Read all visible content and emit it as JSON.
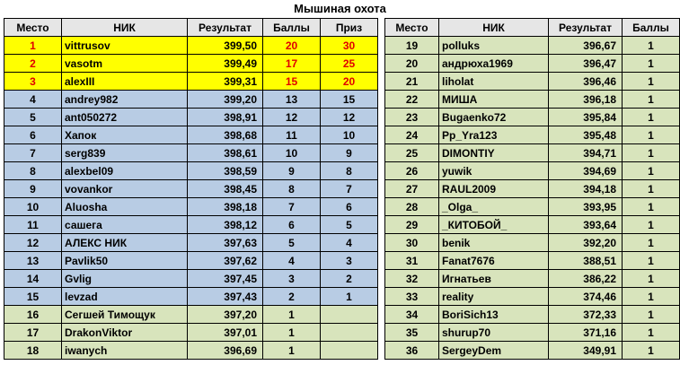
{
  "title": "Мышиная охота",
  "left": {
    "headers": [
      "Место",
      "НИК",
      "Результат",
      "Баллы",
      "Приз"
    ],
    "rows": [
      {
        "place": "1",
        "nick": "vittrusov",
        "result": "399,50",
        "points": "20",
        "prize": "30",
        "style": "gold"
      },
      {
        "place": "2",
        "nick": "vasotm",
        "result": "399,49",
        "points": "17",
        "prize": "25",
        "style": "gold"
      },
      {
        "place": "3",
        "nick": "alexIII",
        "result": "399,31",
        "points": "15",
        "prize": "20",
        "style": "gold"
      },
      {
        "place": "4",
        "nick": "andrey982",
        "result": "399,20",
        "points": "13",
        "prize": "15",
        "style": "blue"
      },
      {
        "place": "5",
        "nick": "ant050272",
        "result": "398,91",
        "points": "12",
        "prize": "12",
        "style": "blue"
      },
      {
        "place": "6",
        "nick": "Хапок",
        "result": "398,68",
        "points": "11",
        "prize": "10",
        "style": "blue"
      },
      {
        "place": "7",
        "nick": "serg839",
        "result": "398,61",
        "points": "10",
        "prize": "9",
        "style": "blue"
      },
      {
        "place": "8",
        "nick": "alexbel09",
        "result": "398,59",
        "points": "9",
        "prize": "8",
        "style": "blue"
      },
      {
        "place": "9",
        "nick": "vovankor",
        "result": "398,45",
        "points": "8",
        "prize": "7",
        "style": "blue"
      },
      {
        "place": "10",
        "nick": "Aluosha",
        "result": "398,18",
        "points": "7",
        "prize": "6",
        "style": "blue"
      },
      {
        "place": "11",
        "nick": "сашега",
        "result": "398,12",
        "points": "6",
        "prize": "5",
        "style": "blue"
      },
      {
        "place": "12",
        "nick": "АЛЕКС НИК",
        "result": "397,63",
        "points": "5",
        "prize": "4",
        "style": "blue"
      },
      {
        "place": "13",
        "nick": "Pavlik50",
        "result": "397,62",
        "points": "4",
        "prize": "3",
        "style": "blue"
      },
      {
        "place": "14",
        "nick": "Gvlig",
        "result": "397,45",
        "points": "3",
        "prize": "2",
        "style": "blue"
      },
      {
        "place": "15",
        "nick": "levzad",
        "result": "397,43",
        "points": "2",
        "prize": "1",
        "style": "blue"
      },
      {
        "place": "16",
        "nick": "Сегшей Тимощук",
        "result": "397,20",
        "points": "1",
        "prize": "",
        "style": "green"
      },
      {
        "place": "17",
        "nick": "DrakonViktor",
        "result": "397,01",
        "points": "1",
        "prize": "",
        "style": "green"
      },
      {
        "place": "18",
        "nick": "iwanych",
        "result": "396,69",
        "points": "1",
        "prize": "",
        "style": "green"
      }
    ]
  },
  "right": {
    "headers": [
      "Место",
      "НИК",
      "Результат",
      "Баллы"
    ],
    "rows": [
      {
        "place": "19",
        "nick": "polluks",
        "result": "396,67",
        "points": "1"
      },
      {
        "place": "20",
        "nick": "андрюха1969",
        "result": "396,47",
        "points": "1"
      },
      {
        "place": "21",
        "nick": "liholat",
        "result": "396,46",
        "points": "1"
      },
      {
        "place": "22",
        "nick": "МИША",
        "result": "396,18",
        "points": "1"
      },
      {
        "place": "23",
        "nick": "Bugaenko72",
        "result": "395,84",
        "points": "1"
      },
      {
        "place": "24",
        "nick": "Pp_Yra123",
        "result": "395,48",
        "points": "1"
      },
      {
        "place": "25",
        "nick": "DIMONTIY",
        "result": "394,71",
        "points": "1"
      },
      {
        "place": "26",
        "nick": "yuwik",
        "result": "394,69",
        "points": "1"
      },
      {
        "place": "27",
        "nick": "RAUL2009",
        "result": "394,18",
        "points": "1"
      },
      {
        "place": "28",
        "nick": "_Olga_",
        "result": "393,95",
        "points": "1"
      },
      {
        "place": "29",
        "nick": "_КИТОБОЙ_",
        "result": "393,64",
        "points": "1"
      },
      {
        "place": "30",
        "nick": "benik",
        "result": "392,20",
        "points": "1"
      },
      {
        "place": "31",
        "nick": "Fanat7676",
        "result": "388,51",
        "points": "1"
      },
      {
        "place": "32",
        "nick": "Игнатьев",
        "result": "386,22",
        "points": "1"
      },
      {
        "place": "33",
        "nick": "reality",
        "result": "374,46",
        "points": "1"
      },
      {
        "place": "34",
        "nick": "BoriSich13",
        "result": "372,33",
        "points": "1"
      },
      {
        "place": "35",
        "nick": "shurup70",
        "result": "371,16",
        "points": "1"
      },
      {
        "place": "36",
        "nick": "SergeyDem",
        "result": "349,91",
        "points": "1"
      }
    ]
  }
}
